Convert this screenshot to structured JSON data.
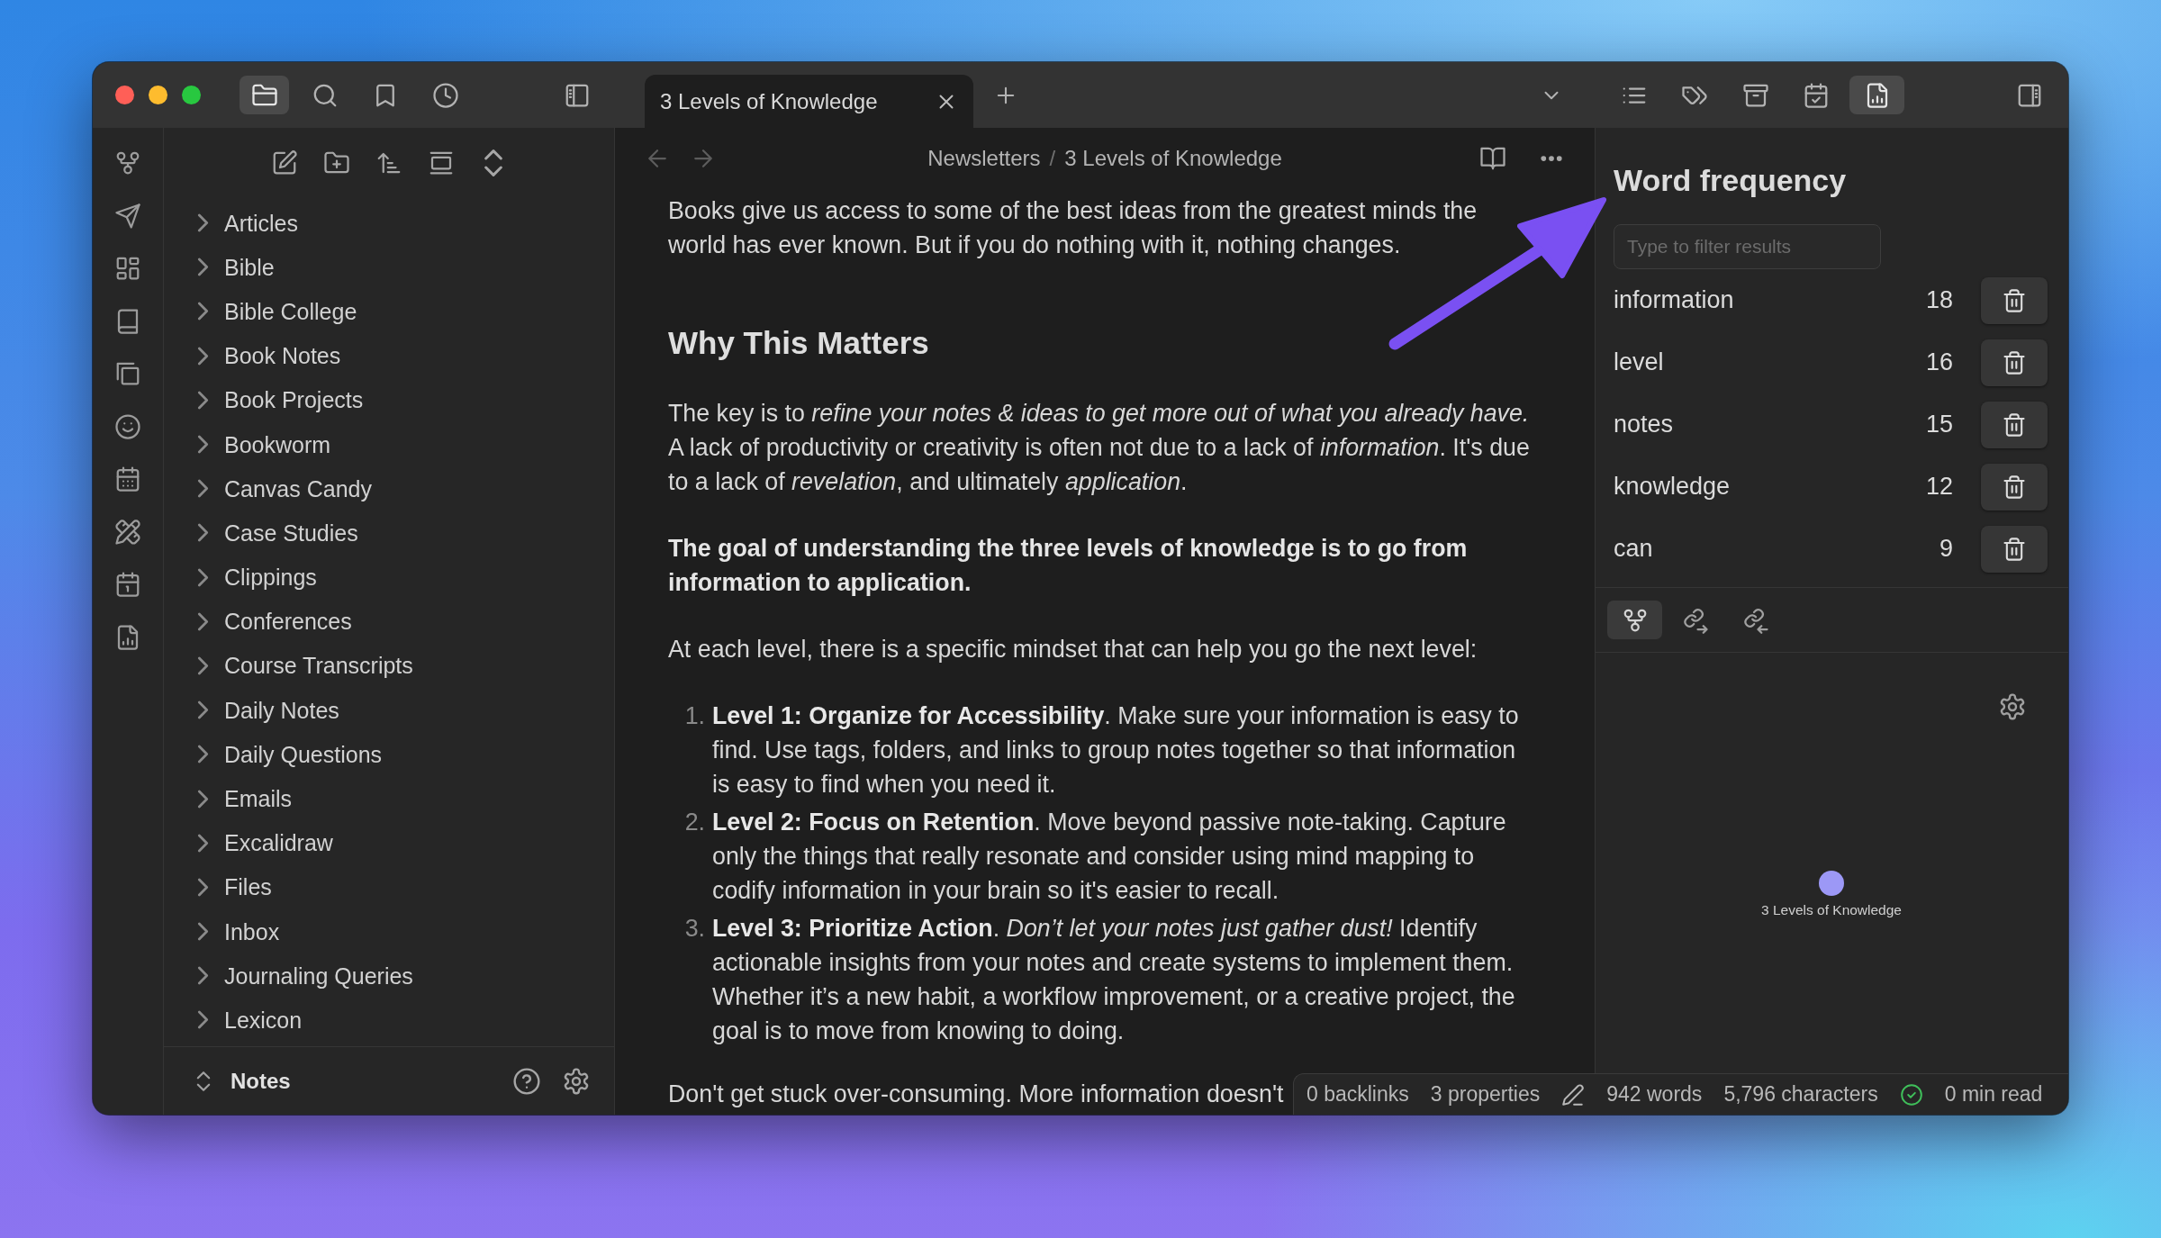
{
  "window": {
    "tabs": [
      {
        "title": "3 Levels of Knowledge",
        "selected": true
      }
    ]
  },
  "explorer_tools": [
    {
      "selected": true
    },
    {
      "selected": false
    },
    {
      "selected": false
    },
    {
      "selected": false
    }
  ],
  "right_tools": [
    {
      "selected": false
    },
    {
      "selected": false
    },
    {
      "selected": false
    },
    {
      "selected": false
    },
    {
      "selected": true
    }
  ],
  "file_tree": {
    "items": [
      {
        "label": "Articles",
        "expanded": false
      },
      {
        "label": "Bible",
        "expanded": false
      },
      {
        "label": "Bible College",
        "expanded": false
      },
      {
        "label": "Book Notes",
        "expanded": false
      },
      {
        "label": "Book Projects",
        "expanded": false
      },
      {
        "label": "Bookworm",
        "expanded": false
      },
      {
        "label": "Canvas Candy",
        "expanded": false
      },
      {
        "label": "Case Studies",
        "expanded": false
      },
      {
        "label": "Clippings",
        "expanded": false
      },
      {
        "label": "Conferences",
        "expanded": false
      },
      {
        "label": "Course Transcripts",
        "expanded": false
      },
      {
        "label": "Daily Notes",
        "expanded": false
      },
      {
        "label": "Daily Questions",
        "expanded": false
      },
      {
        "label": "Emails",
        "expanded": false
      },
      {
        "label": "Excalidraw",
        "expanded": false
      },
      {
        "label": "Files",
        "expanded": false
      },
      {
        "label": "Inbox",
        "expanded": false
      },
      {
        "label": "Journaling Queries",
        "expanded": false
      },
      {
        "label": "Lexicon",
        "expanded": false
      }
    ],
    "vault": "Notes"
  },
  "editor": {
    "nav": [
      {
        "disabled": true
      },
      {
        "disabled": true
      }
    ],
    "breadcrumb": {
      "parts": [
        "Newsletters",
        "3 Levels of Knowledge"
      ],
      "separator": "/"
    },
    "blocks": [
      {
        "kind": "paragraph",
        "text": "Books give us access to some of the best ideas from the greatest minds the world has ever known. But if you do nothing with it, nothing changes."
      },
      {
        "kind": "heading",
        "text": "Why This Matters"
      },
      {
        "kind": "paragraph",
        "text": "The key is to *refine your notes & ideas to get more out of what you already have.* A lack of productivity or creativity is often not due to a lack of *information*. It's due to a lack of *revelation*, and ultimately *application*."
      },
      {
        "kind": "strong",
        "text": "The goal of understanding the three levels of knowledge is to go from information to application."
      },
      {
        "kind": "paragraph",
        "text": "At each level, there is a specific mindset that can help you go the next level:"
      },
      {
        "kind": "list",
        "items": [
          {
            "number": "1.",
            "text": "**Level 1: Organize for Accessibility**. Make sure your information is easy to find. Use tags, folders, and links to group notes together so that information is easy to find when you need it."
          },
          {
            "number": "2.",
            "text": "**Level 2: Focus on Retention**. Move beyond passive note-taking. Capture only the things that really resonate and consider using mind mapping to codify information in your brain so it's easier to recall."
          },
          {
            "number": "3.",
            "text": "**Level 3: Prioritize Action**. *Don’t let your notes just gather dust!* Identify actionable insights from your notes and create systems to implement them. Whether it’s a new habit, a workflow improvement, or a creative project, the goal is to move from knowing to doing."
          }
        ]
      },
      {
        "kind": "paragraph",
        "text": "Don't get stuck over-consuming. More information doesn't"
      }
    ]
  },
  "word_frequency": {
    "title": "Word frequency",
    "filter": {
      "placeholder": "Type to filter results"
    },
    "rows": [
      {
        "word": "information",
        "count": "18"
      },
      {
        "word": "level",
        "count": "16"
      },
      {
        "word": "notes",
        "count": "15"
      },
      {
        "word": "knowledge",
        "count": "12"
      },
      {
        "word": "can",
        "count": "9"
      }
    ]
  },
  "graph": {
    "tabs": [
      {
        "selected": true
      },
      {
        "selected": false
      },
      {
        "selected": false
      }
    ],
    "nodes": [
      {
        "label": "3 Levels of Knowledge"
      }
    ]
  },
  "status_bar": {
    "backlinks": "0 backlinks",
    "properties": "3 properties",
    "words": "942 words",
    "characters": "5,796 characters",
    "synced": true,
    "reading_time": "0 min read"
  },
  "annotation": {
    "kind": "arrow"
  }
}
